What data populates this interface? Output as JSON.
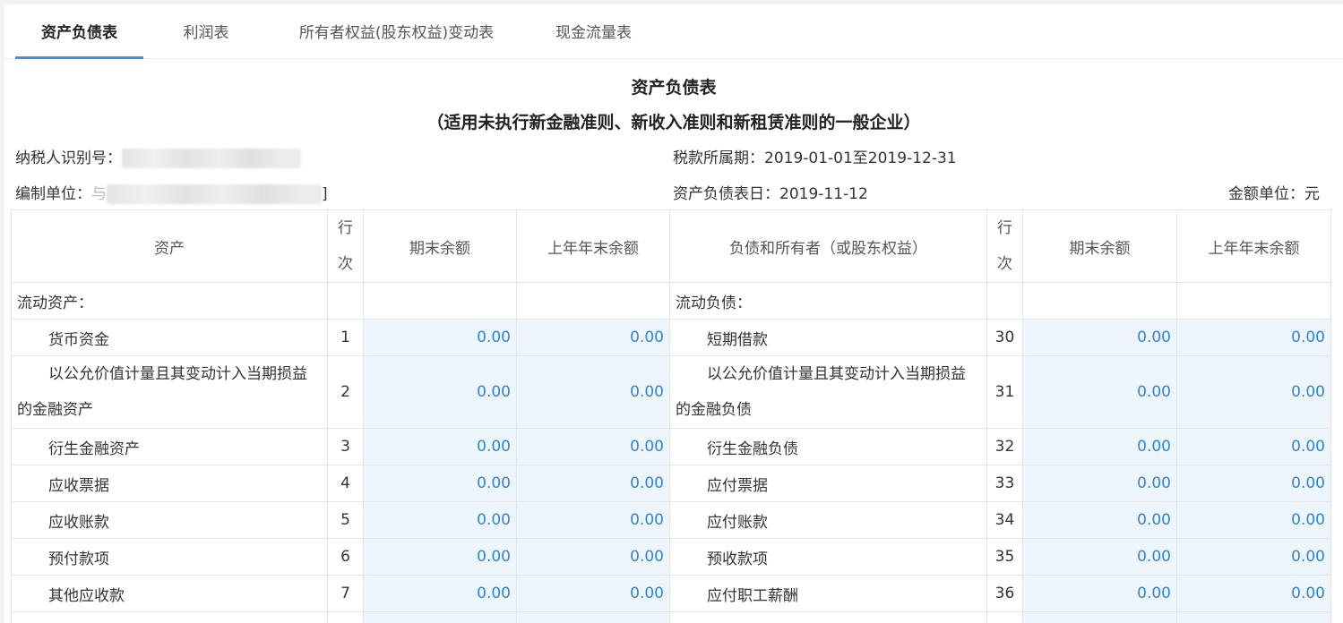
{
  "tabs": [
    {
      "label": "资产负债表",
      "active": true
    },
    {
      "label": "利润表",
      "active": false
    },
    {
      "label": "所有者权益(股东权益)变动表",
      "active": false
    },
    {
      "label": "现金流量表",
      "active": false
    }
  ],
  "report": {
    "title": "资产负债表",
    "subtitle": "（适用未执行新金融准则、新收入准则和新租赁准则的一般企业）",
    "taxpayer_id_label": "纳税人识别号：",
    "period_label": "税款所属期：2019-01-01至2019-12-31",
    "unit_name_label": "编制单位：",
    "unit_name_prefix": "与",
    "unit_name_suffix": "]",
    "balance_date_label": "资产负债表日：2019-11-12",
    "currency_label": "金额单位：元"
  },
  "table": {
    "headers": {
      "asset": "资产",
      "row_no_1": "行",
      "row_no_2": "次",
      "end_balance": "期末余额",
      "prior_balance": "上年年末余额",
      "liability": "负债和所有者（或股东权益）"
    },
    "section_left": "流动资产：",
    "section_right": "流动负债：",
    "rows": [
      {
        "left": "货币资金",
        "lno": "1",
        "l_end": "0.00",
        "l_prior": "0.00",
        "right": "短期借款",
        "rno": "30",
        "r_end": "0.00",
        "r_prior": "0.00"
      },
      {
        "left_1": "以公允价值计量且其变动计入当期损益",
        "left_2": "的金融资产",
        "lno": "2",
        "l_end": "0.00",
        "l_prior": "0.00",
        "right_1": "以公允价值计量且其变动计入当期损益",
        "right_2": "的金融负债",
        "rno": "31",
        "r_end": "0.00",
        "r_prior": "0.00"
      },
      {
        "left": "衍生金融资产",
        "lno": "3",
        "l_end": "0.00",
        "l_prior": "0.00",
        "right": "衍生金融负债",
        "rno": "32",
        "r_end": "0.00",
        "r_prior": "0.00"
      },
      {
        "left": "应收票据",
        "lno": "4",
        "l_end": "0.00",
        "l_prior": "0.00",
        "right": "应付票据",
        "rno": "33",
        "r_end": "0.00",
        "r_prior": "0.00"
      },
      {
        "left": "应收账款",
        "lno": "5",
        "l_end": "0.00",
        "l_prior": "0.00",
        "right": "应付账款",
        "rno": "34",
        "r_end": "0.00",
        "r_prior": "0.00"
      },
      {
        "left": "预付款项",
        "lno": "6",
        "l_end": "0.00",
        "l_prior": "0.00",
        "right": "预收款项",
        "rno": "35",
        "r_end": "0.00",
        "r_prior": "0.00"
      },
      {
        "left": "其他应收款",
        "lno": "7",
        "l_end": "0.00",
        "l_prior": "0.00",
        "right": "应付职工薪酬",
        "rno": "36",
        "r_end": "0.00",
        "r_prior": "0.00"
      }
    ]
  },
  "colors": {
    "accent": "#3d8ee8",
    "amount_text": "#2f86d2",
    "amount_bg": "#eef5fc"
  }
}
